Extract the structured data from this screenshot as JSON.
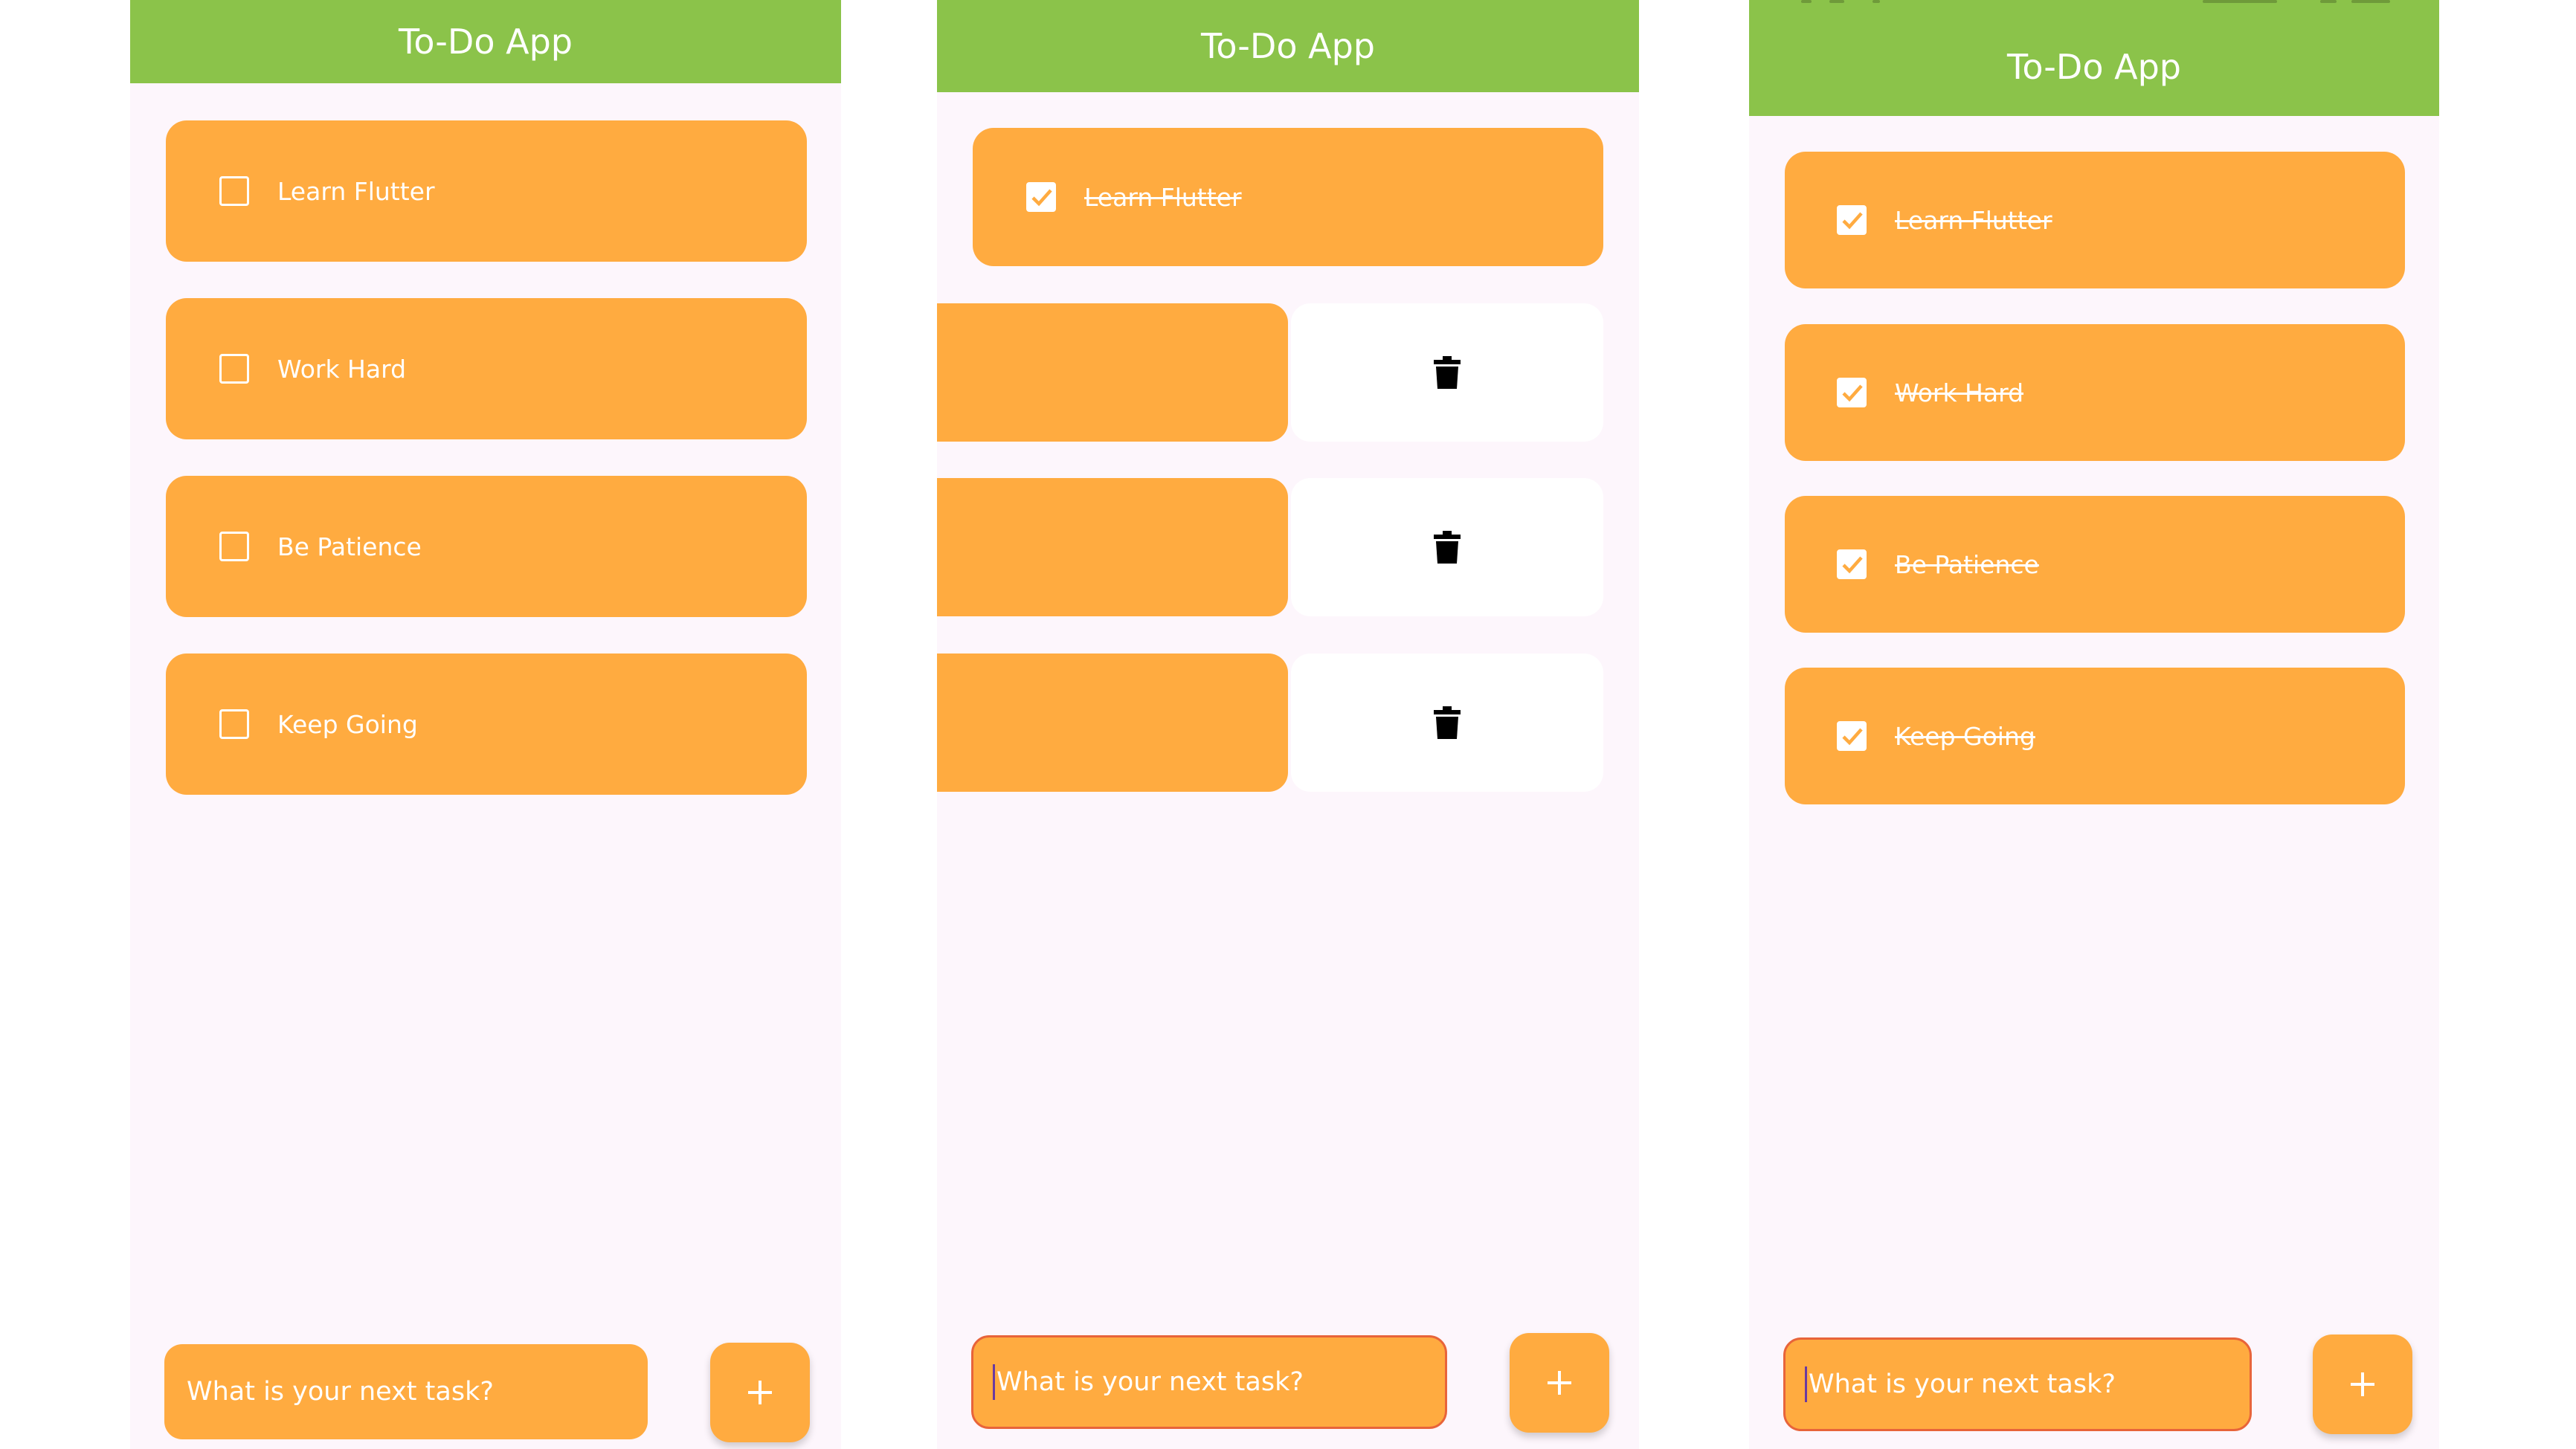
{
  "screens": [
    {
      "title": "To-Do App",
      "tasks": [
        {
          "label": "Learn Flutter",
          "done": false
        },
        {
          "label": "Work Hard",
          "done": false
        },
        {
          "label": "Be Patience",
          "done": false
        },
        {
          "label": "Keep Going",
          "done": false
        }
      ],
      "input": {
        "placeholder": "What is your next task?",
        "focused": false
      },
      "add_button": {
        "icon": "plus-icon"
      }
    },
    {
      "title": "To-Do App",
      "tasks": [
        {
          "label": "Learn Flutter",
          "done": true
        }
      ],
      "swiped_rows": [
        {
          "action_icon": "trash-icon"
        },
        {
          "action_icon": "trash-icon"
        },
        {
          "action_icon": "trash-icon"
        }
      ],
      "input": {
        "placeholder": "What is your next task?",
        "focused": true
      },
      "add_button": {
        "icon": "plus-icon"
      }
    },
    {
      "title": "To-Do App",
      "tasks": [
        {
          "label": "Learn Flutter",
          "done": true
        },
        {
          "label": "Work Hard",
          "done": true
        },
        {
          "label": "Be Patience",
          "done": true
        },
        {
          "label": "Keep Going",
          "done": true
        }
      ],
      "input": {
        "placeholder": "What is your next task?",
        "focused": true
      },
      "add_button": {
        "icon": "plus-icon"
      }
    }
  ],
  "colors": {
    "app_bar": "#8bc34a",
    "task_card": "#ffab40",
    "background": "#fdf6fc",
    "focus_border": "#e8643a"
  }
}
